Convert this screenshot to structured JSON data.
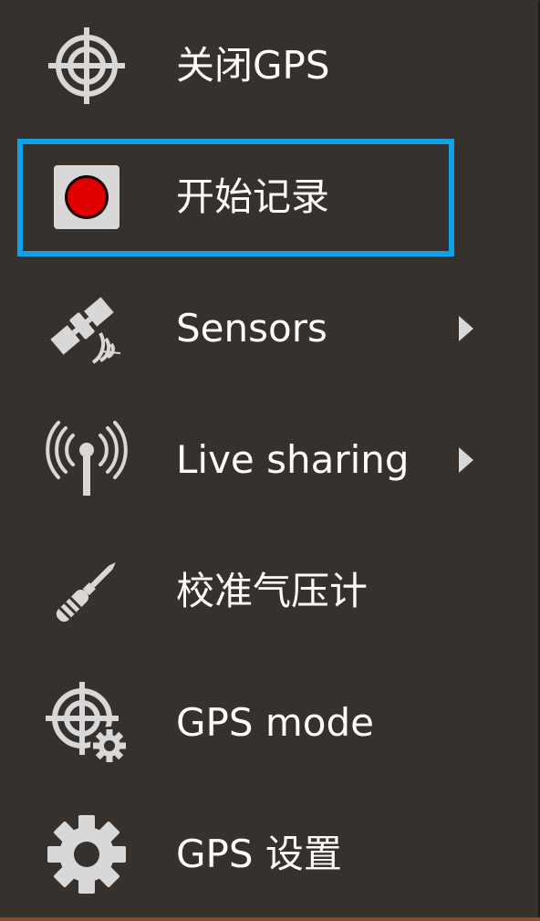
{
  "menu": {
    "items": [
      {
        "label": "关闭GPS",
        "icon": "crosshair-icon",
        "submenu": false
      },
      {
        "label": "开始记录",
        "icon": "record-icon",
        "submenu": false,
        "highlighted": true
      },
      {
        "label": "Sensors",
        "icon": "satellite-icon",
        "submenu": true
      },
      {
        "label": "Live sharing",
        "icon": "antenna-icon",
        "submenu": true
      },
      {
        "label": "校准气压计",
        "icon": "screwdriver-icon",
        "submenu": false
      },
      {
        "label": "GPS mode",
        "icon": "crosshair-gear-icon",
        "submenu": false
      },
      {
        "label": "GPS 设置",
        "icon": "gear-icon",
        "submenu": false
      }
    ]
  },
  "colors": {
    "menu_background": "#37312d",
    "icon_gray": "#d8d8d8",
    "record_red": "#e00000",
    "highlight_blue": "#0fa2e6",
    "text": "#ffffff"
  }
}
